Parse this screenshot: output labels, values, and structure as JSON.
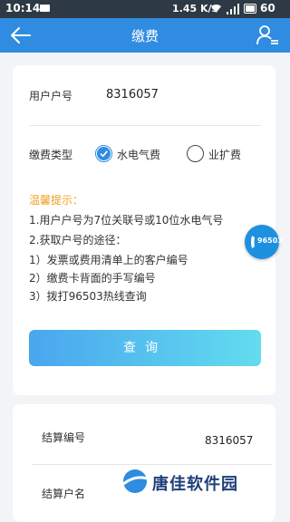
{
  "status_bar": {
    "time": "10:14",
    "speed": "1.45 K/s",
    "battery": "60"
  },
  "app_bar": {
    "title": "缴费",
    "back_icon": "arrow-left-icon",
    "user_icon": "user-list-icon"
  },
  "form": {
    "account_label": "用户户号",
    "account_value": "8316057",
    "type_label": "缴费类型",
    "type_options": [
      {
        "label": "水电气费",
        "checked": true
      },
      {
        "label": "业扩费",
        "checked": false
      }
    ],
    "accent_color": "#2f8ce0"
  },
  "tips": {
    "title": "温馨提示：",
    "lines": [
      "1.用户户号为7位关联号或10位水电气号",
      "2.获取户号的途径：",
      "1）发票或费用清单上的客户编号",
      "2）缴费卡背面的手写编号",
      "3）拨打96503热线查询"
    ]
  },
  "query_button": "查询",
  "hotline_button": "96503",
  "settlement": {
    "number_label": "结算编号",
    "number_value": "8316057",
    "name_label": "结算户名"
  },
  "watermark": "唐佳软件园"
}
